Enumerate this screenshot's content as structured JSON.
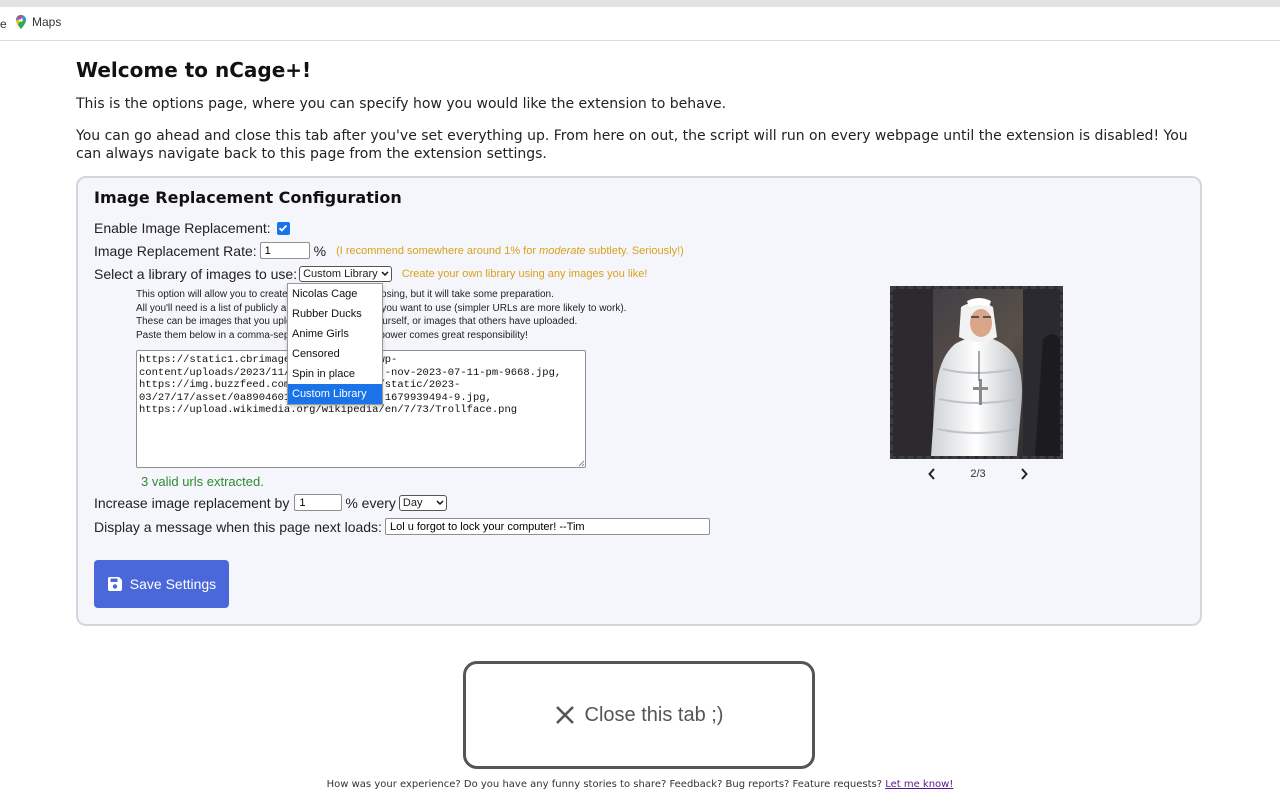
{
  "bookmarks": {
    "edge_text": "e",
    "maps_label": "Maps"
  },
  "page": {
    "title": "Welcome to nCage+!",
    "intro1": "This is the options page, where you can specify how you would like the extension to behave.",
    "intro2": "You can go ahead and close this tab after you've set everything up. From here on out, the script will run on every webpage until the extension is disabled! You can always navigate back to this page from the extension settings."
  },
  "config": {
    "heading": "Image Replacement Configuration",
    "enable_label": "Enable Image Replacement:",
    "enable_checked": true,
    "rate_label": "Image Replacement Rate:",
    "rate_value": "1",
    "rate_unit": "%",
    "rate_hint_prefix": "(I recommend somewhere around 1% for ",
    "rate_hint_em": "moderate",
    "rate_hint_suffix": " subtlety. Seriously!)",
    "library_label": "Select a library of images to use:",
    "library_selected": "Custom Library",
    "library_hint": "Create your own library using any images you like!",
    "library_options": [
      "Nicolas Cage",
      "Rubber Ducks",
      "Anime Girls",
      "Censored",
      "Spin in place",
      "Custom Library"
    ],
    "desc_line1_a": "This option will allow you to create",
    "desc_line1_b": "s of your choosing, but it will take some preparation.",
    "desc_line2_a": "All you'll need is a list of publicly a",
    "desc_line2_b": "images you want to use (simpler URLs are more likely to work).",
    "desc_line3_a": "These can be images that you uplo",
    "desc_line3_b": "yourself, or images that others have uploaded.",
    "desc_line4_a": "Paste them below in a comma-sep",
    "desc_line4_b": "power comes great responsibility!",
    "urls_text": "https://static1.cbrimage              wp-\ncontent/uploads/2023/11/0              -nov-2023-07-11-pm-9668.jpg,\nhttps://img.buzzfeed.com              /static/2023-\n03/27/17/asset/0a8904601              -1679939494-9.jpg,\nhttps://upload.wikimedia.org/wikipedia/en/7/73/Trollface.png",
    "valid_msg": "3 valid urls extracted.",
    "increase_label": "Increase image replacement by",
    "increase_value": "1",
    "increase_every": "% every",
    "increase_period": "Day",
    "message_label": "Display a message when this page next loads:",
    "message_value": "Lol u forgot to lock your computer! --Tim",
    "save_label": "Save Settings",
    "preview_counter": "2/3"
  },
  "close_label": "Close this tab ;)",
  "footer": {
    "text": "How was your experience? Do you have any funny stories to share? Feedback? Bug reports? Feature requests? ",
    "link": "Let me know!"
  },
  "colors": {
    "accent": "#4a68d9",
    "hint": "#d8a21a",
    "valid": "#2e8b2e",
    "selection": "#1a73e8"
  }
}
